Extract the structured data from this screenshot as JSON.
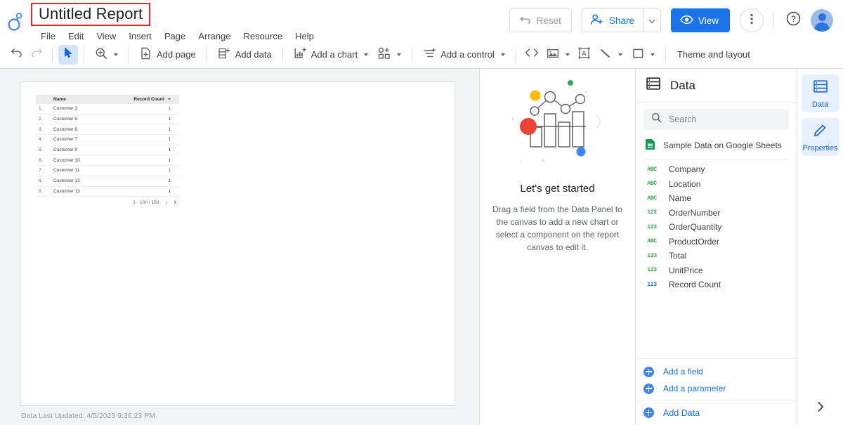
{
  "header": {
    "logo_icon": "looker-studio-logo",
    "report_title": "Untitled Report",
    "menus": [
      "File",
      "Edit",
      "View",
      "Insert",
      "Page",
      "Arrange",
      "Resource",
      "Help"
    ],
    "reset_label": "Reset",
    "reset_icon": "undo-arrow-icon",
    "share_label": "Share",
    "share_icon": "person-add-icon",
    "share_caret_icon": "chevron-down-icon",
    "view_label": "View",
    "view_icon": "eye-icon",
    "more_icon": "more-vert-icon",
    "help_icon": "help-circle-icon",
    "avatar_icon": "user-avatar",
    "accent_blue": "#1a73e8",
    "title_highlight_color": "#e8262b"
  },
  "toolbar": {
    "undo_icon": "undo-icon",
    "redo_icon": "redo-icon",
    "select_icon": "cursor-arrow-icon",
    "zoom_icon": "magnifier-plus-icon",
    "add_page_label": "Add page",
    "add_page_icon": "page-add-icon",
    "add_data_label": "Add data",
    "add_data_icon": "database-add-icon",
    "add_chart_label": "Add a chart",
    "add_chart_icon": "bar-chart-add-icon",
    "community_viz_icon": "community-visualization-icon",
    "add_control_label": "Add a control",
    "add_control_icon": "control-sliders-icon",
    "embed_icon": "code-embed-icon",
    "image_icon": "image-icon",
    "text_icon": "text-box-icon",
    "line_icon": "line-icon",
    "shape_icon": "rectangle-icon",
    "theme_layout_label": "Theme and layout"
  },
  "canvas": {
    "status_text": "Data Last Updated: 4/5/2023 9:36:23 PM",
    "table": {
      "columns": [
        "",
        "Name",
        "Record Count"
      ],
      "sort_indicator_icon": "sort-descending-icon",
      "rows": [
        {
          "index": "1.",
          "name": "Customer 3",
          "count": "1"
        },
        {
          "index": "2.",
          "name": "Customer 5",
          "count": "1"
        },
        {
          "index": "3.",
          "name": "Customer 6",
          "count": "1"
        },
        {
          "index": "4.",
          "name": "Customer 7",
          "count": "1"
        },
        {
          "index": "5.",
          "name": "Customer 9",
          "count": "1"
        },
        {
          "index": "6.",
          "name": "Customer 10",
          "count": "1"
        },
        {
          "index": "7.",
          "name": "Customer 11",
          "count": "1"
        },
        {
          "index": "8.",
          "name": "Customer 12",
          "count": "1"
        },
        {
          "index": "9.",
          "name": "Customer 13",
          "count": "1"
        }
      ],
      "pagination_label": "1 - 100 / 150",
      "prev_icon": "chevron-left-icon",
      "next_icon": "chevron-right-icon"
    }
  },
  "get_started": {
    "illustration_icon": "charts-illustration",
    "title": "Let's get started",
    "description": "Drag a field from the Data Panel to the canvas to add a new chart or select a component on the report canvas to edit it."
  },
  "data_panel": {
    "panel_icon": "data-table-icon",
    "panel_title": "Data",
    "search_placeholder": "Search",
    "search_value": "",
    "search_icon": "search-icon",
    "source_name": "Sample Data on Google Sheets",
    "source_icon": "google-sheets-icon",
    "fields": [
      {
        "type": "ABC",
        "kind": "dim",
        "name": "Company"
      },
      {
        "type": "ABC",
        "kind": "dim",
        "name": "Location"
      },
      {
        "type": "ABC",
        "kind": "dim",
        "name": "Name"
      },
      {
        "type": "123",
        "kind": "dim",
        "name": "OrderNumber"
      },
      {
        "type": "123",
        "kind": "dim",
        "name": "OrderQuantity"
      },
      {
        "type": "ABC",
        "kind": "dim",
        "name": "ProductOrder"
      },
      {
        "type": "123",
        "kind": "dim",
        "name": "Total"
      },
      {
        "type": "123",
        "kind": "dim",
        "name": "UnitPrice"
      },
      {
        "type": "123",
        "kind": "met",
        "name": "Record Count"
      }
    ],
    "add_field_label": "Add a field",
    "add_parameter_label": "Add a parameter",
    "add_data_label": "Add Data",
    "plus_icon": "plus-circle-icon",
    "dimension_color": "#34a853",
    "metric_color": "#1a73e8"
  },
  "rail": {
    "items": [
      {
        "label": "Data",
        "icon": "data-table-icon",
        "selected": true
      },
      {
        "label": "Properties",
        "icon": "pencil-icon",
        "selected": true
      }
    ],
    "collapse_icon": "chevron-right-icon"
  }
}
